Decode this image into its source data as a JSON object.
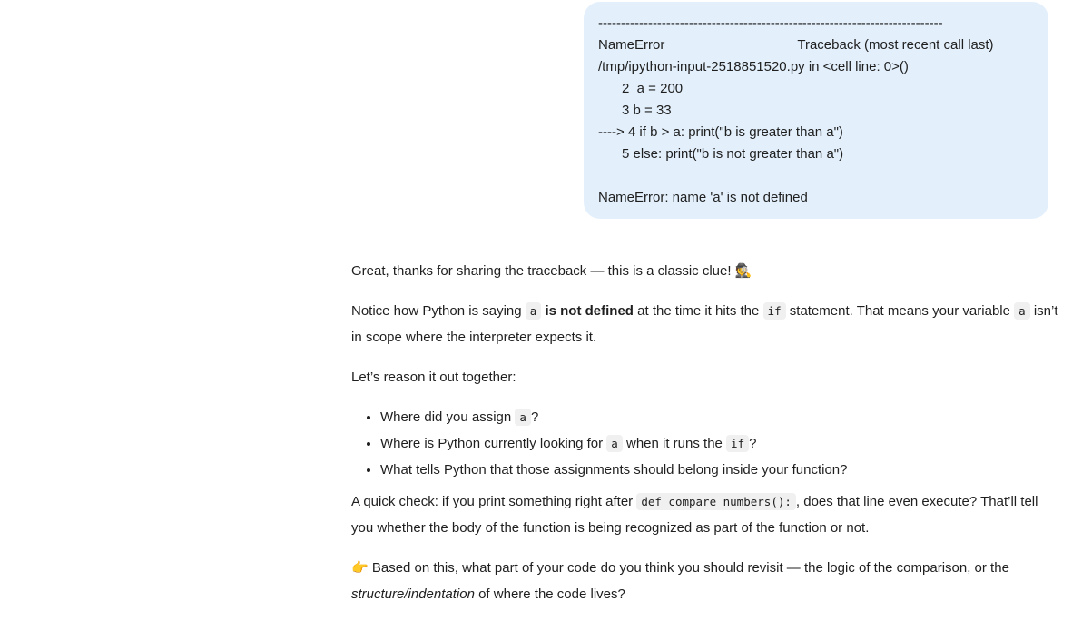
{
  "user_message": {
    "dash_line": "----------------------------------------------------------------------------",
    "error_name": "NameError",
    "traceback_title": "Traceback (most recent call last)",
    "file_line": "/tmp/ipython-input-2518851520.py in <cell line: 0>()",
    "code_lines": [
      "2  a = 200",
      "3 b = 33"
    ],
    "arrow_line": "----> 4 if b > a: print(\"b is greater than a\")",
    "code_line_5": "5 else: print(\"b is not greater than a\")",
    "error_message": "NameError: name 'a' is not defined"
  },
  "assistant": {
    "p1_text": "Great, thanks for sharing the traceback — this is a classic clue! ",
    "p1_emoji": "🕵",
    "p2_a": "Notice how Python is saying ",
    "p2_code1": "a",
    "p2_bold": " is not defined",
    "p2_b": " at the time it hits the ",
    "p2_code2": "if",
    "p2_c": " statement. That means your variable ",
    "p2_code3": "a",
    "p2_d": " isn’t in scope where the interpreter expects it.",
    "p3": "Let’s reason it out together:",
    "bullet1_a": "Where did you assign ",
    "bullet1_code": "a",
    "bullet1_b": "?",
    "bullet2_a": "Where is Python currently looking for ",
    "bullet2_code": "a",
    "bullet2_b": " when it runs the ",
    "bullet2_code2": "if",
    "bullet2_c": "?",
    "bullet3": "What tells Python that those assignments should belong inside your function?",
    "p4_a": "A quick check: if you print something right after ",
    "p4_code": "def compare_numbers():",
    "p4_b": ", does that line even execute? That’ll tell you whether the body of the function is being recognized as part of the function or not.",
    "p5_emoji": "👉",
    "p5_a": " Based on this, what part of your code do you think you should revisit — the logic of the comparison, or the ",
    "p5_italic": "structure/indentation",
    "p5_b": " of where the code lives?"
  }
}
